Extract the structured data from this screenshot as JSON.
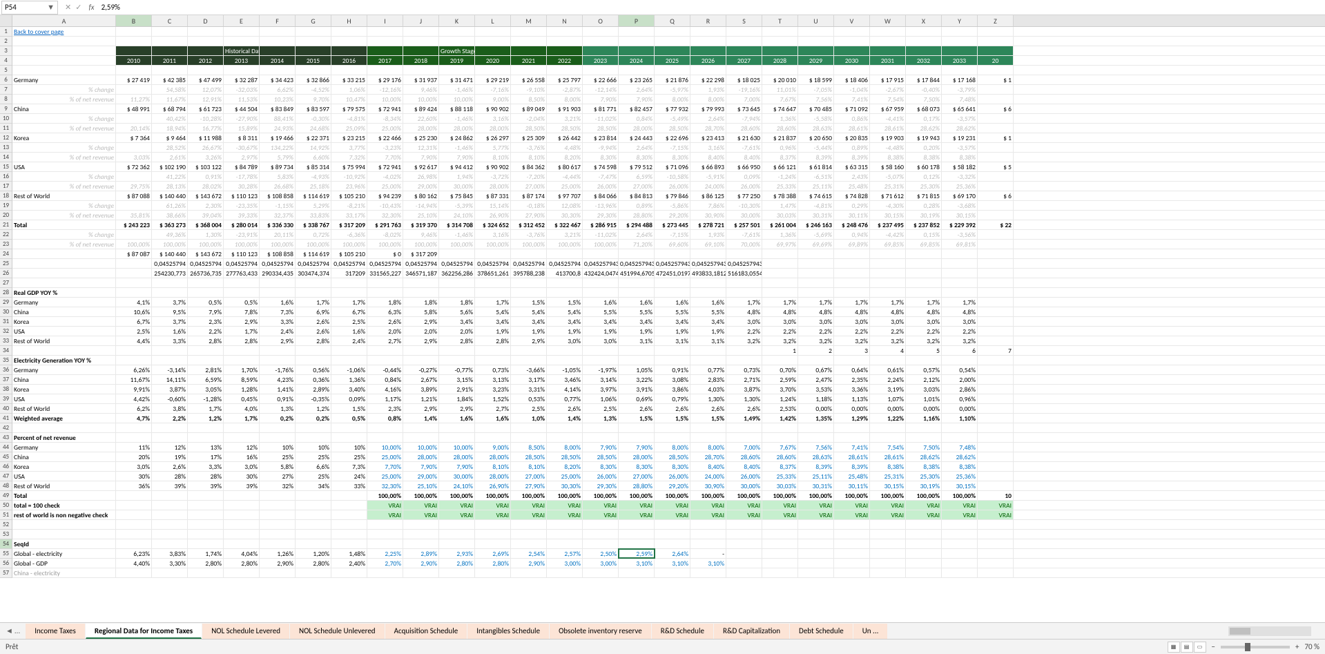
{
  "nameBox": "P54",
  "formulaValue": "2,59%",
  "link": "Back to cover page",
  "headers": {
    "hist": "Historical Data",
    "growth": "Growth Stage One"
  },
  "years": [
    "2010",
    "2011",
    "2012",
    "2013",
    "2014",
    "2015",
    "2016",
    "2017",
    "2018",
    "2019",
    "2020",
    "2021",
    "2022",
    "2023",
    "2024",
    "2025",
    "2026",
    "2027",
    "2028",
    "2029",
    "2030",
    "2031",
    "2032",
    "2033",
    "20"
  ],
  "regions": {
    "Germany": {
      "vals": [
        "27 419",
        "42 385",
        "47 499",
        "32 287",
        "34 423",
        "32 866",
        "33 215",
        "29 176",
        "31 937",
        "31 471",
        "29 219",
        "26 558",
        "25 797",
        "22 666",
        "23 265",
        "21 876",
        "22 298",
        "18 025",
        "20 010",
        "18 599",
        "18 406",
        "17 915",
        "17 844",
        "17 168",
        "1"
      ],
      "chg": [
        "",
        "54,58%",
        "12,07%",
        "-32,03%",
        "6,62%",
        "-4,52%",
        "1,06%",
        "-12,16%",
        "9,46%",
        "-1,46%",
        "-7,16%",
        "-9,10%",
        "-2,87%",
        "-12,14%",
        "2,64%",
        "-5,97%",
        "1,93%",
        "-19,16%",
        "11,01%",
        "-7,05%",
        "-1,04%",
        "-2,67%",
        "-0,40%",
        "-3,79%",
        ""
      ],
      "rev": [
        "11,27%",
        "11,67%",
        "12,91%",
        "11,53%",
        "10,23%",
        "9,70%",
        "10,47%",
        "10,00%",
        "10,00%",
        "10,00%",
        "9,00%",
        "8,50%",
        "8,00%",
        "7,90%",
        "7,90%",
        "8,00%",
        "8,00%",
        "7,00%",
        "7,67%",
        "7,56%",
        "7,41%",
        "7,54%",
        "7,50%",
        "7,48%",
        ""
      ]
    },
    "China": {
      "vals": [
        "48 991",
        "68 794",
        "61 723",
        "44 504",
        "83 849",
        "83 597",
        "79 575",
        "72 941",
        "89 424",
        "88 118",
        "90 902",
        "89 049",
        "91 903",
        "81 771",
        "82 457",
        "77 932",
        "79 993",
        "73 645",
        "74 647",
        "70 485",
        "71 092",
        "67 959",
        "68 073",
        "65 641",
        "6"
      ],
      "chg": [
        "",
        "40,42%",
        "-10,28%",
        "-27,90%",
        "88,41%",
        "-0,30%",
        "-4,81%",
        "-8,34%",
        "22,60%",
        "-1,46%",
        "3,16%",
        "-2,04%",
        "3,21%",
        "-11,02%",
        "0,84%",
        "-5,49%",
        "2,64%",
        "-7,94%",
        "1,36%",
        "-5,58%",
        "0,86%",
        "-4,41%",
        "0,17%",
        "-3,57%",
        ""
      ],
      "rev": [
        "20,14%",
        "18,94%",
        "16,77%",
        "15,89%",
        "24,93%",
        "24,68%",
        "25,09%",
        "25,00%",
        "28,00%",
        "28,00%",
        "28,00%",
        "28,50%",
        "28,50%",
        "28,50%",
        "28,00%",
        "28,50%",
        "28,70%",
        "28,60%",
        "28,60%",
        "28,63%",
        "28,61%",
        "28,61%",
        "28,62%",
        "28,62%",
        ""
      ]
    },
    "Korea": {
      "vals": [
        "7 364",
        "9 464",
        "11 988",
        "8 311",
        "19 466",
        "22 371",
        "23 215",
        "22 466",
        "25 230",
        "24 862",
        "26 297",
        "25 309",
        "26 442",
        "23 814",
        "24 443",
        "22 696",
        "23 413",
        "21 630",
        "21 837",
        "20 650",
        "20 835",
        "19 903",
        "19 943",
        "19 231",
        "1"
      ],
      "chg": [
        "",
        "28,52%",
        "26,67%",
        "-30,67%",
        "134,22%",
        "14,92%",
        "3,77%",
        "-3,23%",
        "12,31%",
        "-1,46%",
        "5,77%",
        "-3,76%",
        "4,48%",
        "-9,94%",
        "2,64%",
        "-7,15%",
        "3,16%",
        "-7,61%",
        "0,96%",
        "-5,44%",
        "0,89%",
        "-4,48%",
        "0,20%",
        "-3,57%",
        ""
      ],
      "rev": [
        "3,03%",
        "2,61%",
        "3,26%",
        "2,97%",
        "5,79%",
        "6,60%",
        "7,32%",
        "7,70%",
        "7,90%",
        "7,90%",
        "8,10%",
        "8,10%",
        "8,20%",
        "8,30%",
        "8,30%",
        "8,30%",
        "8,40%",
        "8,40%",
        "8,37%",
        "8,39%",
        "8,39%",
        "8,38%",
        "8,38%",
        "8,38%",
        ""
      ]
    },
    "USA": {
      "vals": [
        "72 362",
        "102 190",
        "103 122",
        "84 789",
        "89 734",
        "85 314",
        "75 994",
        "72 941",
        "92 617",
        "94 412",
        "90 902",
        "84 362",
        "80 617",
        "74 598",
        "79 512",
        "71 096",
        "66 893",
        "66 950",
        "66 121",
        "61 814",
        "63 315",
        "58 160",
        "60 178",
        "58 182",
        "5"
      ],
      "chg": [
        "",
        "41,22%",
        "0,91%",
        "-17,78%",
        "5,83%",
        "-4,93%",
        "-10,92%",
        "-4,02%",
        "26,98%",
        "1,94%",
        "-3,72%",
        "-7,20%",
        "-4,44%",
        "-7,47%",
        "6,59%",
        "-10,58%",
        "-5,91%",
        "0,09%",
        "-1,24%",
        "-6,51%",
        "2,43%",
        "-5,07%",
        "0,12%",
        "-3,32%",
        ""
      ],
      "rev": [
        "29,75%",
        "28,13%",
        "28,02%",
        "30,28%",
        "26,68%",
        "25,18%",
        "23,96%",
        "25,00%",
        "29,00%",
        "30,00%",
        "28,00%",
        "27,00%",
        "25,00%",
        "26,00%",
        "27,00%",
        "26,00%",
        "24,00%",
        "26,00%",
        "25,33%",
        "25,11%",
        "25,48%",
        "25,31%",
        "25,30%",
        "25,36%",
        ""
      ]
    },
    "RestOfWorld": {
      "vals": [
        "87 088",
        "140 440",
        "143 672",
        "110 123",
        "108 858",
        "114 619",
        "105 210",
        "94 239",
        "80 162",
        "75 845",
        "87 331",
        "87 174",
        "97 707",
        "84 066",
        "84 813",
        "79 846",
        "86 125",
        "77 250",
        "78 388",
        "74 615",
        "74 828",
        "71 612",
        "71 815",
        "69 170",
        "6"
      ],
      "chg": [
        "",
        "61,26%",
        "2,30%",
        "-23,35%",
        "-1,15%",
        "5,29%",
        "-8,21%",
        "-10,43%",
        "-14,94%",
        "-5,39%",
        "15,14%",
        "-0,18%",
        "12,08%",
        "-13,96%",
        "0,89%",
        "-5,86%",
        "7,86%",
        "-10,30%",
        "1,47%",
        "-4,81%",
        "0,29%",
        "-4,30%",
        "0,28%",
        "-3,68%",
        ""
      ],
      "rev": [
        "35,81%",
        "38,66%",
        "39,04%",
        "39,33%",
        "32,37%",
        "33,83%",
        "33,17%",
        "32,30%",
        "25,10%",
        "24,10%",
        "26,90%",
        "27,90%",
        "30,30%",
        "29,30%",
        "28,80%",
        "29,20%",
        "30,90%",
        "30,00%",
        "30,03%",
        "30,31%",
        "30,11%",
        "30,15%",
        "30,19%",
        "30,15%",
        ""
      ]
    },
    "Total": {
      "vals": [
        "243 223",
        "363 273",
        "368 004",
        "280 014",
        "336 330",
        "338 767",
        "317 209",
        "291 763",
        "319 370",
        "314 708",
        "324 652",
        "312 452",
        "322 467",
        "286 915",
        "294 488",
        "273 445",
        "278 721",
        "257 501",
        "261 004",
        "246 163",
        "248 476",
        "237 495",
        "237 852",
        "229 392",
        "22"
      ],
      "chg": [
        "",
        "49,36%",
        "1,30%",
        "-23,91%",
        "20,11%",
        "0,72%",
        "-6,36%",
        "-8,02%",
        "9,46%",
        "-1,46%",
        "3,16%",
        "-3,76%",
        "3,21%",
        "-11,02%",
        "2,64%",
        "-7,15%",
        "1,93%",
        "-7,61%",
        "1,36%",
        "-5,69%",
        "0,94%",
        "-4,42%",
        "0,15%",
        "-3,56%",
        ""
      ],
      "rev": [
        "100,00%",
        "100,00%",
        "100,00%",
        "100,00%",
        "100,00%",
        "100,00%",
        "100,00%",
        "100,00%",
        "100,00%",
        "100,00%",
        "100,00%",
        "100,00%",
        "100,00%",
        "100,00%",
        "71,20%",
        "69,60%",
        "69,10%",
        "70,00%",
        "69,97%",
        "69,69%",
        "69,89%",
        "69,85%",
        "69,85%",
        "69,81%",
        ""
      ]
    }
  },
  "extra": {
    "r23": [
      "87 087",
      "140 440",
      "143 672",
      "110 123",
      "108 858",
      "114 619",
      "105 210",
      "0",
      "317 209",
      "",
      "",
      "",
      "",
      "",
      "",
      "",
      "",
      "",
      "",
      "",
      "",
      "",
      "",
      "",
      ""
    ],
    "r24": [
      "",
      "0,04525794",
      "0,04525794",
      "0,04525794",
      "0,04525794",
      "0,04525794",
      "0,04525794",
      "0,04525794",
      "0,04525794",
      "0,04525794",
      "0,04525794",
      "0,04525794",
      "0,04525794",
      "0,045257943",
      "0,045257943",
      "0,045257943",
      "0,045257943",
      "0,045257943",
      "",
      "",
      "",
      "",
      "",
      "",
      ""
    ],
    "r25": [
      "",
      "254230,773",
      "265736,735",
      "277763,433",
      "290334,435",
      "303474,374",
      "317209",
      "331565,227",
      "346571,187",
      "362256,286",
      "378651,261",
      "395788,238",
      "413700,8",
      "432424,0474",
      "451994,6705",
      "472451,0197",
      "493833,1812",
      "516183,0554",
      "",
      "",
      "",
      "",
      "",
      "",
      ""
    ]
  },
  "gdp": {
    "label": "Real GDP YOY %",
    "Germany": [
      "4,1%",
      "3,7%",
      "0,5%",
      "0,5%",
      "1,6%",
      "1,7%",
      "1,7%",
      "1,8%",
      "1,8%",
      "1,8%",
      "1,7%",
      "1,5%",
      "1,5%",
      "1,6%",
      "1,6%",
      "1,6%",
      "1,6%",
      "1,7%",
      "1,7%",
      "1,7%",
      "1,7%",
      "1,7%",
      "1,7%",
      "1,7%",
      ""
    ],
    "China": [
      "10,6%",
      "9,5%",
      "7,9%",
      "7,8%",
      "7,3%",
      "6,9%",
      "6,7%",
      "6,3%",
      "5,8%",
      "5,6%",
      "5,4%",
      "5,4%",
      "5,4%",
      "5,5%",
      "5,5%",
      "5,5%",
      "5,5%",
      "4,8%",
      "4,8%",
      "4,8%",
      "4,8%",
      "4,8%",
      "4,8%",
      "4,8%",
      ""
    ],
    "Korea": [
      "6,7%",
      "3,7%",
      "2,3%",
      "2,9%",
      "3,3%",
      "2,6%",
      "2,5%",
      "2,6%",
      "2,9%",
      "3,4%",
      "3,4%",
      "3,4%",
      "3,4%",
      "3,4%",
      "3,4%",
      "3,4%",
      "3,4%",
      "3,0%",
      "3,0%",
      "3,0%",
      "3,0%",
      "3,0%",
      "3,0%",
      "3,0%",
      ""
    ],
    "USA": [
      "2,5%",
      "1,6%",
      "2,2%",
      "1,7%",
      "2,4%",
      "2,6%",
      "1,6%",
      "2,0%",
      "2,0%",
      "2,0%",
      "1,9%",
      "1,9%",
      "1,9%",
      "1,9%",
      "1,9%",
      "1,9%",
      "1,9%",
      "2,2%",
      "2,2%",
      "2,2%",
      "2,2%",
      "2,2%",
      "2,2%",
      "2,2%",
      ""
    ],
    "RestOfWorld": [
      "4,4%",
      "3,3%",
      "2,8%",
      "2,8%",
      "2,9%",
      "2,8%",
      "2,4%",
      "2,7%",
      "2,9%",
      "2,8%",
      "2,8%",
      "2,9%",
      "3,0%",
      "3,0%",
      "3,1%",
      "3,1%",
      "3,1%",
      "3,2%",
      "3,2%",
      "3,2%",
      "3,2%",
      "3,2%",
      "3,2%",
      "3,2%",
      ""
    ]
  },
  "seq": {
    "r33": [
      "",
      "",
      "",
      "",
      "",
      "",
      "",
      "",
      "",
      "",
      "",
      "",
      "",
      "",
      "",
      "",
      "",
      "",
      "1",
      "2",
      "3",
      "4",
      "5",
      "6",
      "7"
    ]
  },
  "elec": {
    "label": "Electricity Generation YOY %",
    "Germany": [
      "6,26%",
      "-3,14%",
      "2,81%",
      "1,70%",
      "-1,76%",
      "0,56%",
      "-1,06%",
      "-0,44%",
      "-0,27%",
      "-0,77%",
      "0,73%",
      "-3,66%",
      "-1,05%",
      "-1,97%",
      "1,05%",
      "0,91%",
      "0,77%",
      "0,73%",
      "0,70%",
      "0,67%",
      "0,64%",
      "0,61%",
      "0,57%",
      "0,54%",
      ""
    ],
    "China": [
      "11,67%",
      "14,11%",
      "6,59%",
      "8,59%",
      "4,23%",
      "0,36%",
      "1,36%",
      "0,84%",
      "2,67%",
      "3,15%",
      "3,13%",
      "3,17%",
      "3,46%",
      "3,14%",
      "3,22%",
      "3,08%",
      "2,83%",
      "2,71%",
      "2,59%",
      "2,47%",
      "2,35%",
      "2,24%",
      "2,12%",
      "2,00%",
      ""
    ],
    "Korea": [
      "9,91%",
      "3,87%",
      "3,05%",
      "1,28%",
      "1,41%",
      "2,89%",
      "3,40%",
      "4,16%",
      "3,89%",
      "2,91%",
      "3,23%",
      "3,31%",
      "4,14%",
      "3,97%",
      "3,91%",
      "3,86%",
      "4,03%",
      "3,87%",
      "3,70%",
      "3,53%",
      "3,36%",
      "3,19%",
      "3,03%",
      "2,86%",
      ""
    ],
    "USA": [
      "4,42%",
      "-0,60%",
      "-1,28%",
      "0,45%",
      "0,91%",
      "-0,35%",
      "0,09%",
      "1,17%",
      "1,21%",
      "1,84%",
      "1,52%",
      "0,53%",
      "0,77%",
      "1,06%",
      "0,69%",
      "0,79%",
      "1,30%",
      "1,30%",
      "1,24%",
      "1,18%",
      "1,13%",
      "1,07%",
      "1,01%",
      "0,96%",
      ""
    ],
    "RestOfWorld": [
      "6,2%",
      "3,8%",
      "1,7%",
      "4,0%",
      "1,3%",
      "1,2%",
      "1,5%",
      "2,3%",
      "2,9%",
      "2,9%",
      "2,7%",
      "2,5%",
      "2,6%",
      "2,5%",
      "2,6%",
      "2,6%",
      "2,6%",
      "2,6%",
      "2,53%",
      "0,00%",
      "0,00%",
      "0,00%",
      "0,00%",
      "0,00%",
      ""
    ],
    "Weighted": [
      "4,7%",
      "2,2%",
      "1,2%",
      "1,7%",
      "0,2%",
      "0,2%",
      "0,5%",
      "0,8%",
      "1,4%",
      "1,6%",
      "1,6%",
      "1,0%",
      "1,4%",
      "1,3%",
      "1,5%",
      "1,5%",
      "1,5%",
      "1,49%",
      "1,42%",
      "1,35%",
      "1,29%",
      "1,22%",
      "1,16%",
      "1,10%",
      ""
    ]
  },
  "pct": {
    "label": "Percent of net revenue",
    "Germany": [
      "11%",
      "12%",
      "13%",
      "12%",
      "10%",
      "10%",
      "10%",
      "10,00%",
      "10,00%",
      "10,00%",
      "9,00%",
      "8,50%",
      "8,00%",
      "7,90%",
      "7,90%",
      "8,00%",
      "8,00%",
      "7,00%",
      "7,67%",
      "7,56%",
      "7,41%",
      "7,54%",
      "7,50%",
      "7,48%",
      ""
    ],
    "China": [
      "20%",
      "19%",
      "17%",
      "16%",
      "25%",
      "25%",
      "25%",
      "25,00%",
      "28,00%",
      "28,00%",
      "28,00%",
      "28,50%",
      "28,50%",
      "28,50%",
      "28,00%",
      "28,50%",
      "28,70%",
      "28,60%",
      "28,60%",
      "28,63%",
      "28,61%",
      "28,61%",
      "28,62%",
      "28,62%",
      ""
    ],
    "Korea": [
      "3,0%",
      "2,6%",
      "3,3%",
      "3,0%",
      "5,8%",
      "6,6%",
      "7,3%",
      "7,70%",
      "7,90%",
      "7,90%",
      "8,10%",
      "8,10%",
      "8,20%",
      "8,30%",
      "8,30%",
      "8,30%",
      "8,40%",
      "8,40%",
      "8,37%",
      "8,39%",
      "8,39%",
      "8,38%",
      "8,38%",
      "8,38%",
      ""
    ],
    "USA": [
      "30%",
      "28%",
      "28%",
      "30%",
      "27%",
      "25%",
      "24%",
      "25,00%",
      "29,00%",
      "30,00%",
      "28,00%",
      "27,00%",
      "25,00%",
      "26,00%",
      "27,00%",
      "26,00%",
      "24,00%",
      "26,00%",
      "25,33%",
      "25,11%",
      "25,48%",
      "25,31%",
      "25,30%",
      "25,36%",
      ""
    ],
    "RestOfWorld": [
      "36%",
      "39%",
      "39%",
      "39%",
      "32%",
      "34%",
      "33%",
      "32,30%",
      "25,10%",
      "24,10%",
      "26,90%",
      "27,90%",
      "30,30%",
      "29,30%",
      "28,80%",
      "29,20%",
      "30,90%",
      "30,00%",
      "30,03%",
      "30,31%",
      "30,11%",
      "30,15%",
      "30,19%",
      "30,15%",
      ""
    ],
    "Total": [
      "",
      "",
      "",
      "",
      "",
      "",
      "",
      "100,00%",
      "100,00%",
      "100,00%",
      "100,00%",
      "100,00%",
      "100,00%",
      "100,00%",
      "100,00%",
      "100,00%",
      "100,00%",
      "100,00%",
      "100,00%",
      "100,00%",
      "100,00%",
      "100,00%",
      "100,00%",
      "100,00%",
      "10"
    ]
  },
  "checks": {
    "total100": "total = 100 check",
    "rowNonNeg": "rest of world is non negative check",
    "vrai": "VRAI"
  },
  "seqid": {
    "label": "SeqId",
    "GlobalElec": [
      "6,23%",
      "3,83%",
      "1,74%",
      "4,04%",
      "1,26%",
      "1,20%",
      "1,48%",
      "2,25%",
      "2,89%",
      "2,93%",
      "2,69%",
      "2,54%",
      "2,57%",
      "2,50%",
      "2,59%",
      "2,64%",
      "-",
      "",
      "",
      "",
      "",
      "",
      "",
      "",
      ""
    ],
    "GlobalGDP": [
      "4,40%",
      "3,30%",
      "2,80%",
      "2,80%",
      "2,90%",
      "2,80%",
      "2,40%",
      "2,70%",
      "2,90%",
      "2,80%",
      "2,80%",
      "2,90%",
      "3,00%",
      "3,00%",
      "3,10%",
      "3,10%",
      "3,10%",
      "",
      "",
      "",
      "",
      "",
      "",
      "",
      ""
    ]
  },
  "rowLabels": {
    "Germany": "Germany",
    "China": "China",
    "Korea": "Korea",
    "USA": "USA",
    "RestOfWorld": "Rest of World",
    "Total": "Total",
    "change": "% change",
    "netrev": "% of net revenue",
    "Weighted": "Weighted average",
    "GlobalElec": "Global - electricity",
    "GlobalGDP": "Global - GDP",
    "ChinaElec": "China - electricity"
  },
  "tabs": {
    "list": [
      "Income Taxes",
      "Regional Data for Income Taxes",
      "NOL Schedule Levered",
      "NOL Schedule Unlevered",
      "Acquisition Schedule",
      "Intangibles Schedule",
      "Obsolete inventory reserve",
      "R&D Schedule",
      "R&D Capitalization",
      "Debt Schedule",
      "Un  ..."
    ],
    "active": 1
  },
  "status": {
    "ready": "Prêt",
    "zoom": "70 %"
  },
  "colWidths": {
    "A": 150,
    "data": 52
  }
}
